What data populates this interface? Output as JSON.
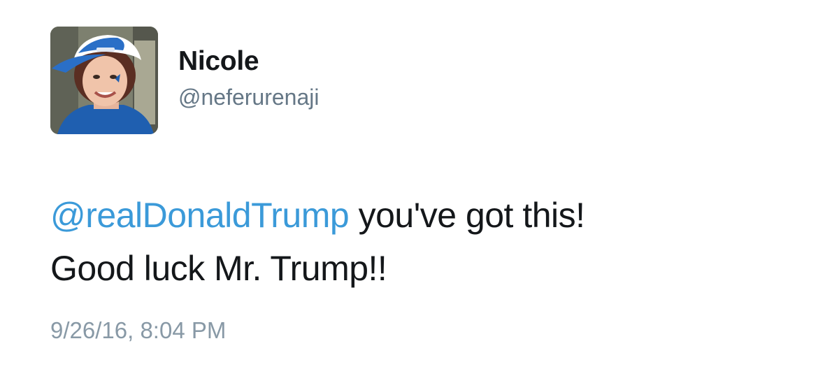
{
  "tweet": {
    "author_name": "Nicole",
    "author_handle": "@neferurenaji",
    "avatar_icon": "profile-photo",
    "mention": "@realDonaldTrump",
    "line1_rest": " you've got this!",
    "line2": "Good luck Mr. Trump!!",
    "timestamp": "9/26/16, 8:04 PM",
    "colors": {
      "mention": "#3b9ad9",
      "handle": "#657786",
      "timestamp": "#8899a6",
      "text": "#14171a"
    }
  }
}
